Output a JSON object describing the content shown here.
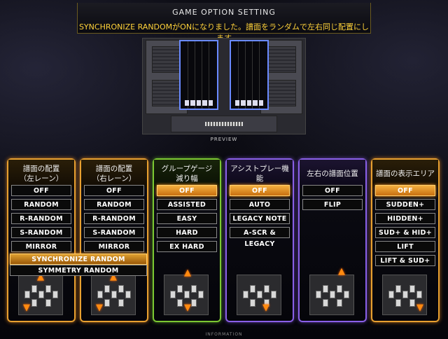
{
  "header": {
    "title": "GAME OPTION SETTING",
    "message": "SYNCHRONIZE RANDOMがONになりました。譜面をランダムで左右同じ配置にします"
  },
  "preview": {
    "label": "PREVIEW"
  },
  "footer": {
    "info": "INFORMATION"
  },
  "colors": {
    "orange": "#e8a030",
    "green": "#7cc832",
    "purple": "#8a60e8",
    "selected": "#f4b040"
  },
  "columns": [
    {
      "title": "譜面の配置\n（左レーン）",
      "options": [
        "OFF",
        "RANDOM",
        "R-RANDOM",
        "S-RANDOM",
        "MIRROR"
      ],
      "selected_index": -1
    },
    {
      "title": "譜面の配置\n（右レーン）",
      "options": [
        "OFF",
        "RANDOM",
        "R-RANDOM",
        "S-RANDOM",
        "MIRROR"
      ],
      "selected_index": -1
    },
    {
      "title": "グループゲージ\n減り幅",
      "options": [
        "OFF",
        "ASSISTED EASY",
        "EASY",
        "HARD",
        "EX HARD"
      ],
      "selected_index": 0
    },
    {
      "title": "アシストプレー機能",
      "options": [
        "OFF",
        "AUTO SCRATCH",
        "LEGACY NOTE",
        "A-SCR & LEGACY"
      ],
      "selected_index": 0
    },
    {
      "title": "左右の譜面位置",
      "options": [
        "OFF",
        "FLIP"
      ],
      "selected_index": 0
    },
    {
      "title": "譜面の表示エリア",
      "options": [
        "OFF",
        "SUDDEN+",
        "HIDDEN+",
        "SUD+ & HID+",
        "LIFT",
        "LIFT & SUD+"
      ],
      "selected_index": 0
    }
  ],
  "shared_options": [
    {
      "label": "SYNCHRONIZE RANDOM",
      "selected": true
    },
    {
      "label": "SYMMETRY RANDOM",
      "selected": false
    }
  ]
}
